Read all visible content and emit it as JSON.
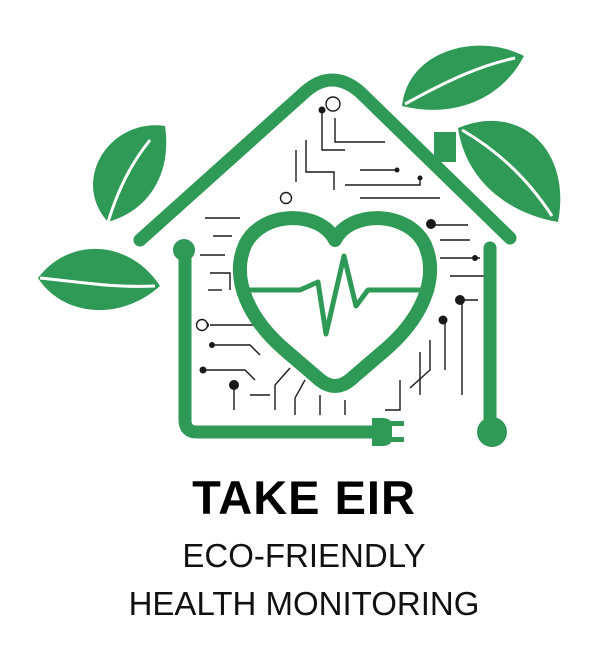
{
  "logo": {
    "title": "TAKE EIR",
    "tagline_line1": "ECO-FRIENDLY",
    "tagline_line2": "HEALTH MONITORING",
    "icons": [
      "house-outline-icon",
      "heart-icon",
      "heartbeat-icon",
      "leaf-icon",
      "circuit-traces-icon",
      "power-plug-icon"
    ]
  },
  "colors": {
    "green": "#2e9a56",
    "text": "#000000",
    "circuit": "#1a1a1a"
  }
}
